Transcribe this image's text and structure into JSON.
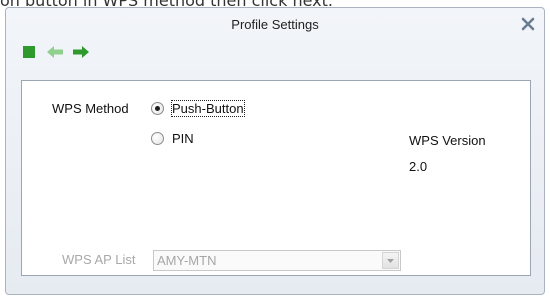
{
  "page_text_top": "on button  in WPS method then click next.",
  "dialog": {
    "title": "Profile Settings",
    "close_glyph": "✕"
  },
  "toolbar": {
    "icons": [
      "stop-square-icon",
      "back-arrow-icon",
      "forward-arrow-icon"
    ],
    "colors": {
      "green": "#2e9a2e",
      "light_green": "#8fd08f"
    }
  },
  "wps": {
    "method_label": "WPS Method",
    "options": [
      {
        "label": "Push-Button",
        "selected": true
      },
      {
        "label": "PIN",
        "selected": false
      }
    ],
    "version_label": "WPS Version",
    "version_value": "2.0",
    "ap_list_label": "WPS AP List",
    "ap_list_value": "AMY-MTN"
  }
}
